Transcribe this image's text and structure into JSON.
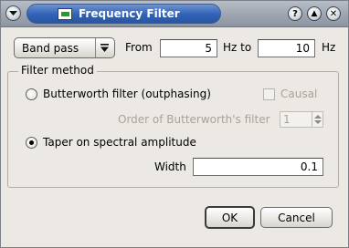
{
  "window": {
    "title": "Frequency Filter",
    "left_button_icon": "chevron-down-icon",
    "title_icon": "app-window-icon",
    "right_buttons": [
      {
        "name": "help-button",
        "icon": "question-icon",
        "glyph": "?"
      },
      {
        "name": "shade-button",
        "icon": "triangle-up-icon",
        "glyph": "▲"
      },
      {
        "name": "close-button",
        "icon": "close-icon",
        "glyph": "✕"
      }
    ]
  },
  "filter": {
    "type_value": "Band pass",
    "from_label": "From",
    "from_value": "5",
    "hz_to_label": "Hz to",
    "to_value": "10",
    "hz_label": "Hz"
  },
  "method": {
    "group_title": "Filter method",
    "butterworth_label": "Butterworth filter (outphasing)",
    "causal_label": "Causal",
    "order_label": "Order of Butterworth's filter",
    "order_value": "1",
    "taper_label": "Taper on spectral amplitude",
    "width_label": "Width",
    "width_value": "0.1",
    "selected": "taper"
  },
  "buttons": {
    "ok": "OK",
    "cancel": "Cancel"
  },
  "colors": {
    "title_active": "#2f62b8",
    "window_bg": "#ece9e4"
  }
}
